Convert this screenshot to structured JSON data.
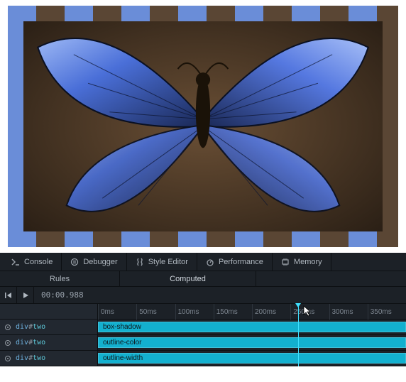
{
  "preview": {
    "element_tag": "div",
    "element_id": "two",
    "border_colors": [
      "#6a8dd8",
      "#5a4634"
    ]
  },
  "devtools": {
    "tabs": [
      {
        "label": "Console",
        "icon": "console-icon"
      },
      {
        "label": "Debugger",
        "icon": "debugger-icon"
      },
      {
        "label": "Style Editor",
        "icon": "style-editor-icon"
      },
      {
        "label": "Performance",
        "icon": "performance-icon"
      },
      {
        "label": "Memory",
        "icon": "memory-icon"
      }
    ],
    "subtabs": {
      "rules_label": "Rules",
      "computed_label": "Computed",
      "active": "Computed"
    },
    "playback": {
      "rewind_label": "Rewind",
      "play_label": "Play",
      "time": "00:00.988"
    },
    "timeline": {
      "ruler_ticks": [
        "0ms",
        "50ms",
        "100ms",
        "150ms",
        "200ms",
        "250ms",
        "300ms",
        "350ms"
      ],
      "scrubber_ms": 260,
      "max_ms": 400,
      "tracks": [
        {
          "tag": "div",
          "id": "two",
          "property": "box-shadow",
          "bar_width_pct": 100
        },
        {
          "tag": "div",
          "id": "two",
          "property": "outline-color",
          "bar_width_pct": 100
        },
        {
          "tag": "div",
          "id": "two",
          "property": "outline-width",
          "bar_width_pct": 100
        }
      ]
    },
    "colors": {
      "panel_bg": "#1c2127",
      "bar_color": "#13b0cf",
      "scrubber": "#3fe0ff"
    }
  }
}
